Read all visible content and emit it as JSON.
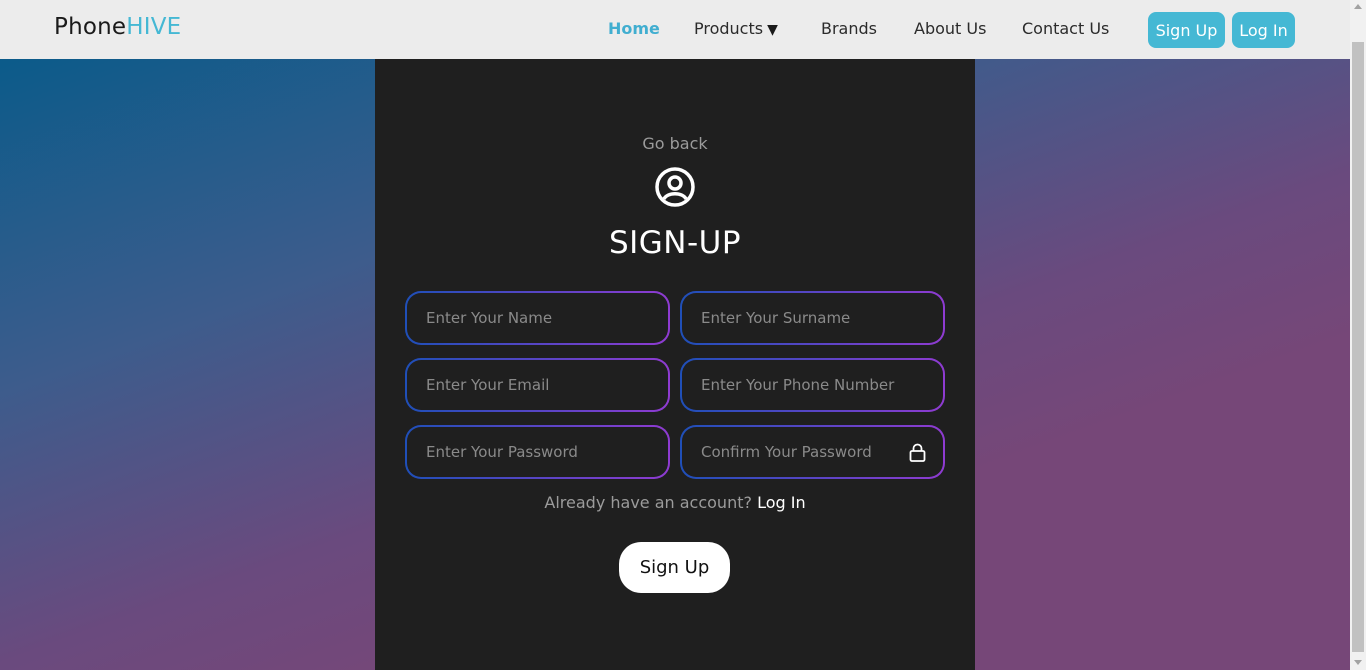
{
  "nav": {
    "logo_part1": "Phone",
    "logo_part2": "HIVE",
    "links": {
      "home": "Home",
      "products": "Products",
      "brands": "Brands",
      "about": "About Us",
      "contact": "Contact Us"
    },
    "products_caret": "▼",
    "signup_label": "Sign Up",
    "login_label": "Log In"
  },
  "form": {
    "go_back": "Go back",
    "title": "SIGN-UP",
    "fields": {
      "name_placeholder": "Enter Your Name",
      "surname_placeholder": "Enter Your Surname",
      "email_placeholder": "Enter Your Email",
      "phone_placeholder": "Enter Your Phone Number",
      "password_placeholder": "Enter Your Password",
      "confirm_placeholder": "Confirm Your Password"
    },
    "account_prompt": "Already have an account?",
    "login_link": "Log In",
    "submit_label": "Sign Up"
  },
  "icons": {
    "user": "user-circle-icon",
    "lock": "lock-icon"
  },
  "colors": {
    "accent": "#45b8d4",
    "panel": "#1f1f1f",
    "navbar": "#ececec",
    "field_border_start": "#1f4fb8",
    "field_border_end": "#8f3bd1"
  }
}
